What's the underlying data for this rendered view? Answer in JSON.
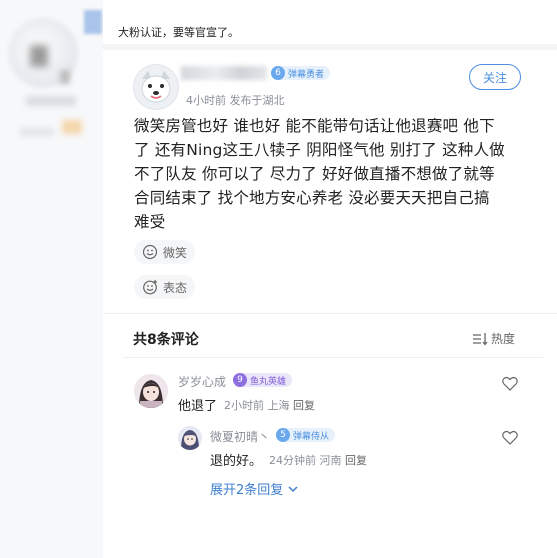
{
  "caption": "大粉认证，要等官宣了。",
  "post": {
    "author_level": "6",
    "author_level_title": "弹幕勇者",
    "time": "4小时前",
    "location": "发布于湖北",
    "follow_label": "关注",
    "lines": [
      "微笑房管也好 谁也好 能不能带句话让他退赛吧 他下",
      "了 还有Ning这王八犊子 阴阳怪气他 别打了 这种人做",
      "不了队友 你可以了 尽力了 好好做直播不想做了就等",
      "合同结束了 找个地方安心养老 没必要天天把自己搞",
      "难受"
    ],
    "tag_label": "微笑",
    "react_label": "表态"
  },
  "comments_header": {
    "title": "共8条评论",
    "sort_label": "热度"
  },
  "comments": [
    {
      "name": "岁岁心成",
      "level": "9",
      "level_title": "鱼丸英雄",
      "text": "他退了",
      "time": "2小时前",
      "location": "上海",
      "reply_label": "回复"
    },
    {
      "name": "微夏初晴丶",
      "level": "5",
      "level_title": "弹幕侍从",
      "text": "退的好。",
      "time": "24分钟前",
      "location": "河南",
      "reply_label": "回复"
    }
  ],
  "expand_label": "展开2条回复",
  "colors": {
    "accent": "#4a8fe0",
    "link": "#3d7fcf",
    "muted": "#8a8f98"
  }
}
